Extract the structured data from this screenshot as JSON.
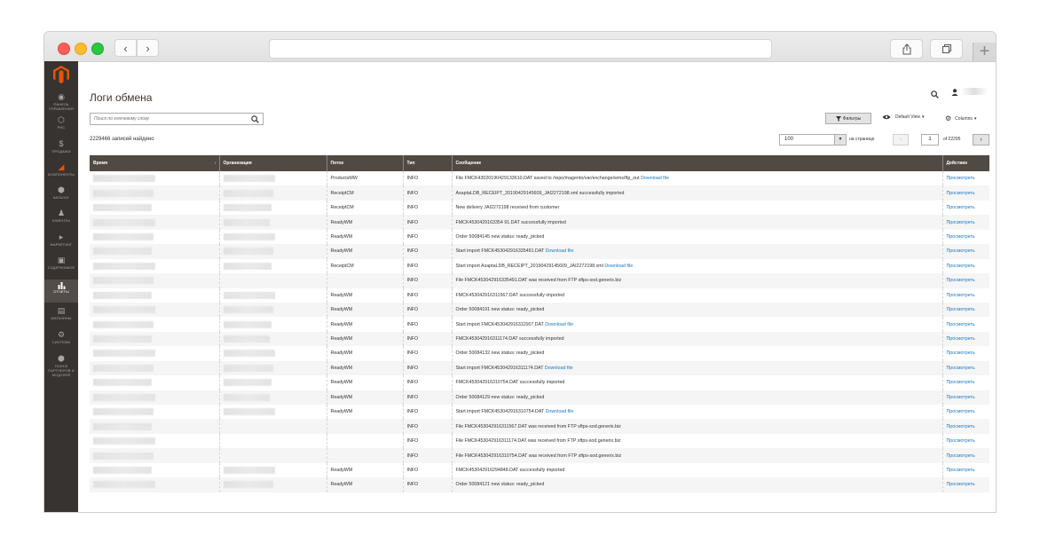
{
  "page": {
    "title": "Логи обмена",
    "search_placeholder": "Поиск по ключевому слову",
    "filters_label": "Фильтры",
    "view_label": "Default View",
    "columns_label": "Columns",
    "records_found": "2229466 записей найдено",
    "per_page_value": "100",
    "per_page_label": "на странице",
    "current_page": "1",
    "total_pages_label": "of 22295"
  },
  "sidebar": {
    "items": [
      {
        "label": "Панель управления",
        "icon": "dashboard-icon"
      },
      {
        "label": "РИС",
        "icon": "hexagon-icon"
      },
      {
        "label": "Продажи",
        "icon": "dollar-icon"
      },
      {
        "label": "Компоненты",
        "icon": "puzzle-icon"
      },
      {
        "label": "Каталог",
        "icon": "cube-icon"
      },
      {
        "label": "Клиенты",
        "icon": "person-icon"
      },
      {
        "label": "Маркетинг",
        "icon": "megaphone-icon"
      },
      {
        "label": "Содержимое",
        "icon": "layout-icon"
      },
      {
        "label": "Отчеты",
        "icon": "bar-chart-icon"
      },
      {
        "label": "Магазины",
        "icon": "store-icon"
      },
      {
        "label": "Система",
        "icon": "gear-icon"
      },
      {
        "label": "Поиск партнеров и модулей",
        "icon": "box-icon"
      }
    ]
  },
  "table": {
    "headers": [
      "Время",
      "Организация",
      "Поток",
      "Тип",
      "Сообщение",
      "Действие"
    ],
    "action_label": "Просмотреть",
    "rows": [
      {
        "flow": "ProductsMW",
        "type": "INFO",
        "message": "File FMCK43020190429133610.DAT saved to /repo/magento/var/exchange/wms/ftp_out",
        "link": "Download file"
      },
      {
        "flow": "ReceiptCM",
        "type": "INFO",
        "message": "AxaptaLDB_RECEIPT_20190429145609_JAI2272198.xml successfully imported",
        "link": ""
      },
      {
        "flow": "ReceiptCM",
        "type": "INFO",
        "message": "New delivery JAI2272198 received from customer",
        "link": ""
      },
      {
        "flow": "ReadyWM",
        "type": "INFO",
        "message": "FMCK4530429163354 91.DAT successfully imported",
        "link": ""
      },
      {
        "flow": "ReadyWM",
        "type": "INFO",
        "message": "Order 50084145 new status: ready_picked",
        "link": ""
      },
      {
        "flow": "ReadyWM",
        "type": "INFO",
        "message": "Start import FMCK453042916335491.DAT",
        "link": "Download file"
      },
      {
        "flow": "ReceiptCM",
        "type": "INFO",
        "message": "Start import AxaptaLDB_RECEIPT_20190429145609_JAI2272198.xml",
        "link": "Download file"
      },
      {
        "flow": "",
        "type": "INFO",
        "message": "File FMCK453042916335491.DAT was received from FTP sftps-sod.generix.biz",
        "link": ""
      },
      {
        "flow": "ReadyWM",
        "type": "INFO",
        "message": "FMCK453042916311567.DAT successfully imported",
        "link": ""
      },
      {
        "flow": "ReadyWM",
        "type": "INFO",
        "message": "Order 50084191 new status: ready_picked",
        "link": ""
      },
      {
        "flow": "ReadyWM",
        "type": "INFO",
        "message": "Start import FMCK453042916311567.DAT",
        "link": "Download file"
      },
      {
        "flow": "ReadyWM",
        "type": "INFO",
        "message": "FMCK453042916311174.DAT successfully imported",
        "link": ""
      },
      {
        "flow": "ReadyWM",
        "type": "INFO",
        "message": "Order 50084132 new status: ready_picked",
        "link": ""
      },
      {
        "flow": "ReadyWM",
        "type": "INFO",
        "message": "Start import FMCK453042916311174.DAT",
        "link": "Download file"
      },
      {
        "flow": "ReadyWM",
        "type": "INFO",
        "message": "FMCK453042916310754.DAT successfully imported",
        "link": ""
      },
      {
        "flow": "ReadyWM",
        "type": "INFO",
        "message": "Order 50084129 new status: ready_picked",
        "link": ""
      },
      {
        "flow": "ReadyWM",
        "type": "INFO",
        "message": "Start import FMCK453042916310754.DAT",
        "link": "Download file"
      },
      {
        "flow": "",
        "type": "INFO",
        "message": "File FMCK453042916311567.DAT was received from FTP sftps-sod.generix.biz",
        "link": ""
      },
      {
        "flow": "",
        "type": "INFO",
        "message": "File FMCK453042916311174.DAT was received from FTP sftps-sod.generix.biz",
        "link": ""
      },
      {
        "flow": "",
        "type": "INFO",
        "message": "File FMCK453042916310754.DAT was received from FTP sftps-sod.generix.biz",
        "link": ""
      },
      {
        "flow": "ReadyWM",
        "type": "INFO",
        "message": "FMCK453042916294848.DAT successfully imported",
        "link": ""
      },
      {
        "flow": "ReadyWM",
        "type": "INFO",
        "message": "Order 50084121 new status: ready_picked",
        "link": ""
      }
    ]
  },
  "colors": {
    "sidebar_bg": "#373330",
    "header_bg": "#514943",
    "link": "#1979c3",
    "logo": "#eb5202"
  }
}
